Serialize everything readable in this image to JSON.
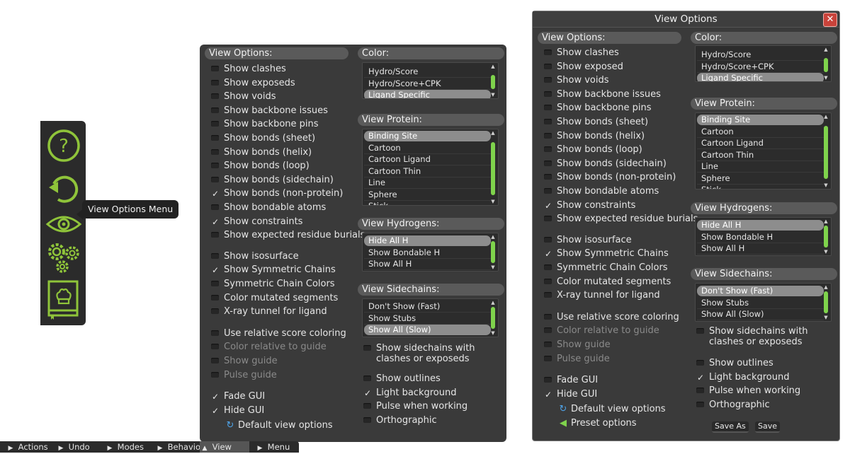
{
  "sidebar": {
    "help_icon": "question-circle-icon",
    "undo_icon": "undo-arrow-icon",
    "view_icon": "eye-icon",
    "modes_icon": "gears-icon",
    "cookbook_icon": "cookbook-icon",
    "icon_color": "#8fc43a",
    "tooltip": "View Options Menu"
  },
  "panel1": {
    "view_options_header": "View Options:",
    "options": [
      {
        "label": "Show clashes",
        "checked": false
      },
      {
        "label": "Show exposeds",
        "checked": false
      },
      {
        "label": "Show voids",
        "checked": false
      },
      {
        "label": "Show backbone issues",
        "checked": false
      },
      {
        "label": "Show backbone pins",
        "checked": false
      },
      {
        "label": "Show bonds (sheet)",
        "checked": false
      },
      {
        "label": "Show bonds (helix)",
        "checked": false
      },
      {
        "label": "Show bonds (loop)",
        "checked": false
      },
      {
        "label": "Show bonds (sidechain)",
        "checked": false
      },
      {
        "label": "Show bonds (non-protein)",
        "checked": true
      },
      {
        "label": "Show bondable atoms",
        "checked": false
      },
      {
        "label": "Show constraints",
        "checked": true
      },
      {
        "label": "Show expected residue burials",
        "checked": false
      },
      {
        "label": "Show isosurface",
        "checked": false
      },
      {
        "label": "Show Symmetric Chains",
        "checked": true
      },
      {
        "label": "Symmetric Chain Colors",
        "checked": false
      },
      {
        "label": "Color mutated segments",
        "checked": false
      },
      {
        "label": "X-ray tunnel for ligand",
        "checked": false
      },
      {
        "label": "Use relative score coloring",
        "checked": false
      },
      {
        "label": "Color relative to guide",
        "checked": false,
        "disabled": true
      },
      {
        "label": "Show guide",
        "checked": false,
        "disabled": true
      },
      {
        "label": "Pulse guide",
        "checked": false,
        "disabled": true
      },
      {
        "label": "Fade GUI",
        "checked": true
      },
      {
        "label": "Hide GUI",
        "checked": true
      }
    ],
    "default_view": "Default view options",
    "color_header": "Color:",
    "color_items": [
      "Hydro/Score",
      "Hydro/Score+CPK",
      "Ligand Specific"
    ],
    "protein_header": "View Protein:",
    "protein_items": [
      "Binding Site",
      "Cartoon",
      "Cartoon Ligand",
      "Cartoon Thin",
      "Line",
      "Sphere",
      "Stick"
    ],
    "hydrogens_header": "View Hydrogens:",
    "hydrogen_items": [
      "Hide All H",
      "Show Bondable H",
      "Show All H"
    ],
    "sidechains_header": "View Sidechains:",
    "sidechain_items": [
      "Don't Show (Fast)",
      "Show Stubs",
      "Show All (Slow)"
    ],
    "sidechains_clashes": "Show sidechains with clashes or exposeds",
    "right_options": [
      {
        "label": "Show outlines",
        "checked": false
      },
      {
        "label": "Light background",
        "checked": true
      },
      {
        "label": "Pulse when working",
        "checked": false
      },
      {
        "label": "Orthographic",
        "checked": false
      }
    ]
  },
  "panel2": {
    "title": "View Options",
    "close_label": "✕",
    "view_options_header": "View Options:",
    "options": [
      {
        "label": "Show clashes",
        "checked": false
      },
      {
        "label": "Show exposed",
        "checked": false
      },
      {
        "label": "Show voids",
        "checked": false
      },
      {
        "label": "Show backbone issues",
        "checked": false
      },
      {
        "label": "Show backbone pins",
        "checked": false
      },
      {
        "label": "Show bonds (sheet)",
        "checked": false
      },
      {
        "label": "Show bonds (helix)",
        "checked": false
      },
      {
        "label": "Show bonds (loop)",
        "checked": false
      },
      {
        "label": "Show bonds (sidechain)",
        "checked": false
      },
      {
        "label": "Show bonds (non-protein)",
        "checked": false
      },
      {
        "label": "Show bondable atoms",
        "checked": false
      },
      {
        "label": "Show constraints",
        "checked": true
      },
      {
        "label": "Show expected residue burials",
        "checked": false
      },
      {
        "label": "Show isosurface",
        "checked": false
      },
      {
        "label": "Show Symmetric Chains",
        "checked": true
      },
      {
        "label": "Symmetric Chain Colors",
        "checked": false
      },
      {
        "label": "Color mutated segments",
        "checked": false
      },
      {
        "label": "X-ray tunnel for ligand",
        "checked": false
      },
      {
        "label": "Use relative score coloring",
        "checked": false
      },
      {
        "label": "Color relative to guide",
        "checked": false,
        "disabled": true
      },
      {
        "label": "Show guide",
        "checked": false,
        "disabled": true
      },
      {
        "label": "Pulse guide",
        "checked": false,
        "disabled": true
      },
      {
        "label": "Fade GUI",
        "checked": false
      },
      {
        "label": "Hide GUI",
        "checked": true
      }
    ],
    "default_view": "Default view options",
    "preset_options": "Preset options",
    "color_header": "Color:",
    "color_items": [
      "Hydro/Score",
      "Hydro/Score+CPK",
      "Ligand Specific"
    ],
    "protein_header": "View Protein:",
    "protein_items": [
      "Binding Site",
      "Cartoon",
      "Cartoon Ligand",
      "Cartoon Thin",
      "Line",
      "Sphere",
      "Stick"
    ],
    "hydrogens_header": "View Hydrogens:",
    "hydrogen_items": [
      "Hide All H",
      "Show Bondable H",
      "Show All H"
    ],
    "sidechains_header": "View Sidechains:",
    "sidechain_items": [
      "Don't Show (Fast)",
      "Show Stubs",
      "Show All (Slow)"
    ],
    "sidechains_clashes": "Show sidechains with clashes or exposeds",
    "right_options": [
      {
        "label": "Show outlines",
        "checked": false
      },
      {
        "label": "Light background",
        "checked": true
      },
      {
        "label": "Pulse when working",
        "checked": false
      },
      {
        "label": "Orthographic",
        "checked": false
      }
    ],
    "save_as": "Save As",
    "save": "Save"
  },
  "bottombar": {
    "items": [
      {
        "label": "Actions",
        "icon": "▶"
      },
      {
        "label": "Undo",
        "icon": "▶"
      },
      {
        "label": "Modes",
        "icon": "▶"
      },
      {
        "label": "Behavior",
        "icon": "▶"
      },
      {
        "label": "View",
        "icon": "▲",
        "active": true
      },
      {
        "label": "Menu",
        "icon": "▶"
      }
    ]
  },
  "colors": {
    "panel_bg": "#3a3a3a",
    "header_bg": "#5a5a5a",
    "scroll_thumb": "#7fd34c",
    "selected_item": "#8d8d8d"
  }
}
